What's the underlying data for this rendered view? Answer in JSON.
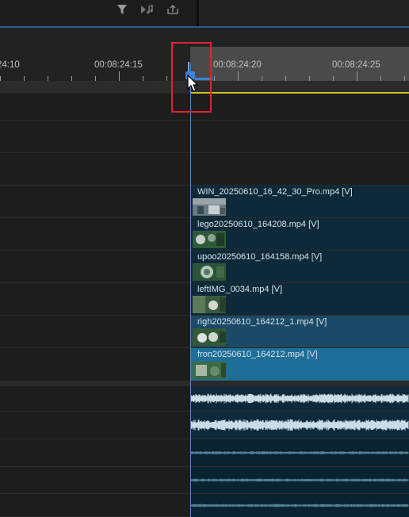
{
  "toolbar": {
    "filter_icon": "funnel-icon",
    "tool2_icon": "snap-music-icon",
    "tool3_icon": "export-frame-icon"
  },
  "ruler": {
    "timecodes": [
      "24:10",
      "00:08:24:15",
      "00:08:24:20",
      "00:08:24:25"
    ]
  },
  "clips": [
    {
      "label": "WIN_20250610_16_42_30_Pro.mp4 [V]"
    },
    {
      "label": "lego20250610_164208.mp4 [V]"
    },
    {
      "label": "upoo20250610_164158.mp4 [V]"
    },
    {
      "label": "leftIMG_0034.mp4 [V]"
    },
    {
      "label": "righ20250610_164212_1.mp4 [V]"
    },
    {
      "label": "fron20250610_164212.mp4 [V]"
    }
  ],
  "colors": {
    "clip_dark": "#0e2a3a",
    "clip_mid": "#1a4a66",
    "clip_selected": "#1f6e98",
    "playhead": "#3b82d8",
    "inout_marker": "#d4c21e",
    "highlight": "#e0242c"
  }
}
